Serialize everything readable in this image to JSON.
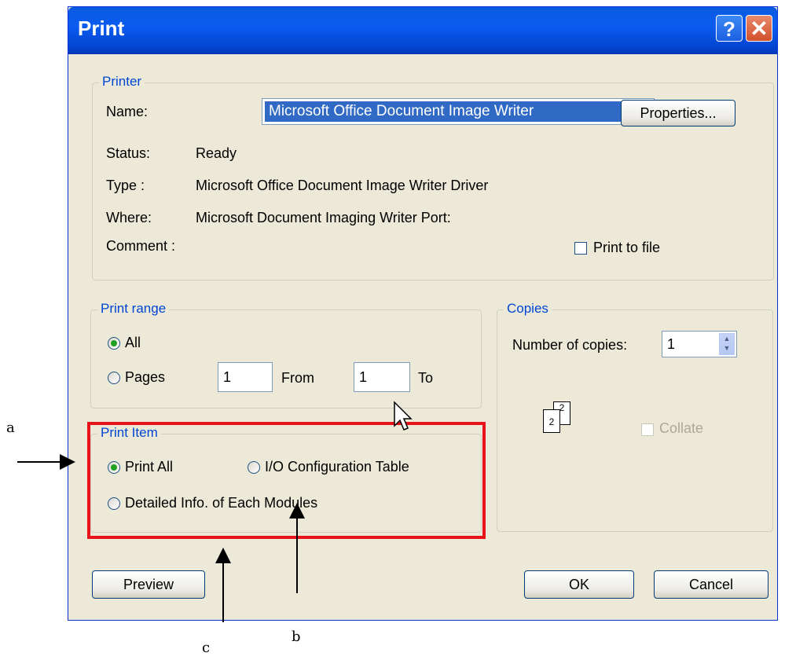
{
  "window": {
    "title": "Print",
    "help_glyph": "?",
    "close_glyph": "✕"
  },
  "printer": {
    "legend": "Printer",
    "name_label": "Name:",
    "name_value": "Microsoft Office Document Image Writer",
    "properties_label": "Properties...",
    "status_label": "Status:",
    "status_value": "Ready",
    "type_label": "Type :",
    "type_value": "Microsoft Office Document Image Writer Driver",
    "where_label": "Where:",
    "where_value": "Microsoft Document Imaging Writer Port:",
    "comment_label": "Comment :",
    "print_to_file_label": "Print to file"
  },
  "print_range": {
    "legend": "Print range",
    "all_label": "All",
    "pages_label": "Pages",
    "from_value": "1",
    "from_label": "From",
    "to_value": "1",
    "to_label": "To"
  },
  "copies": {
    "legend": "Copies",
    "number_label": "Number of copies:",
    "number_value": "1",
    "collate_label": "Collate",
    "page_back": "2",
    "page_front": "2"
  },
  "print_item": {
    "legend": "Print Item",
    "print_all_label": "Print All",
    "io_config_label": "I/O Configuration Table",
    "detailed_label": "Detailed Info. of Each Modules"
  },
  "buttons": {
    "preview": "Preview",
    "ok": "OK",
    "cancel": "Cancel"
  },
  "annotations": {
    "a": "a",
    "b": "b",
    "c": "c"
  },
  "colors": {
    "title_bar": "#0b5cf0",
    "highlight_box": "#e8121a",
    "legend_text": "#0046d5"
  }
}
